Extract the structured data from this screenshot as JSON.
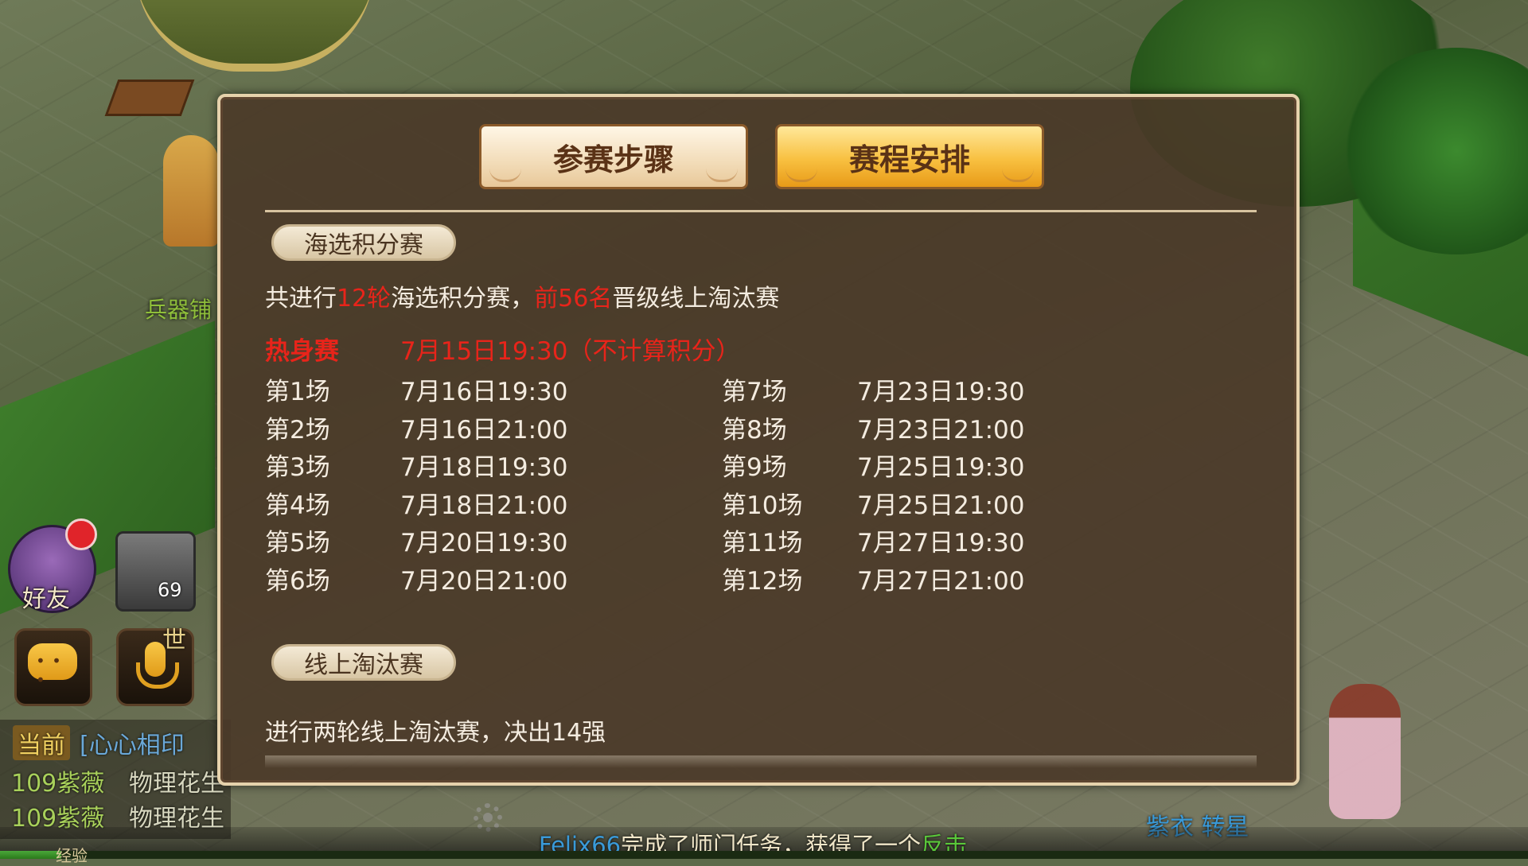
{
  "scene": {
    "shop_label": "兵器铺",
    "right_player_name": "紫衣 转星"
  },
  "hud": {
    "friends_label": "好友",
    "portrait_level": "69",
    "world_tag": "世"
  },
  "chat": {
    "tab_label": "当前",
    "channel_text": "[心心相印",
    "line1_user": "109紫薇",
    "line1_msg": "物理花生",
    "line2_user": "109紫薇",
    "line2_msg": "物理花生"
  },
  "ticker": {
    "user": "Felix66",
    "message": "完成了师门任务，获得了一个",
    "item": "反击"
  },
  "exp": {
    "label": "经验",
    "fill_fraction": 0.04
  },
  "dialog": {
    "tabs": [
      {
        "label": "参赛步骤",
        "active": false
      },
      {
        "label": "赛程安排",
        "active": true
      }
    ],
    "section1": {
      "title": "海选积分赛",
      "desc_pre": "共进行",
      "desc_rounds": "12轮",
      "desc_mid": "海选积分赛，",
      "desc_top": "前56名",
      "desc_post": "晋级线上淘汰赛"
    },
    "warmup": {
      "label": "热身赛",
      "time": "7月15日19:30（不计算积分）"
    },
    "schedule_left": [
      {
        "label": "第1场",
        "time": "7月16日19:30"
      },
      {
        "label": "第2场",
        "time": "7月16日21:00"
      },
      {
        "label": "第3场",
        "time": "7月18日19:30"
      },
      {
        "label": "第4场",
        "time": "7月18日21:00"
      },
      {
        "label": "第5场",
        "time": "7月20日19:30"
      },
      {
        "label": "第6场",
        "time": "7月20日21:00"
      }
    ],
    "schedule_right": [
      {
        "label": "第7场",
        "time": "7月23日19:30"
      },
      {
        "label": "第8场",
        "time": "7月23日21:00"
      },
      {
        "label": "第9场",
        "time": "7月25日19:30"
      },
      {
        "label": "第10场",
        "time": "7月25日21:00"
      },
      {
        "label": "第11场",
        "time": "7月27日19:30"
      },
      {
        "label": "第12场",
        "time": "7月27日21:00"
      }
    ],
    "section2": {
      "title": "线上淘汰赛",
      "desc": "进行两轮线上淘汰赛，决出14强"
    }
  },
  "colors": {
    "highlight_red": "#e8241a",
    "active_tab": "#f8c040",
    "inactive_tab": "#f2dcb8",
    "panel_bg": "#4a3828"
  }
}
